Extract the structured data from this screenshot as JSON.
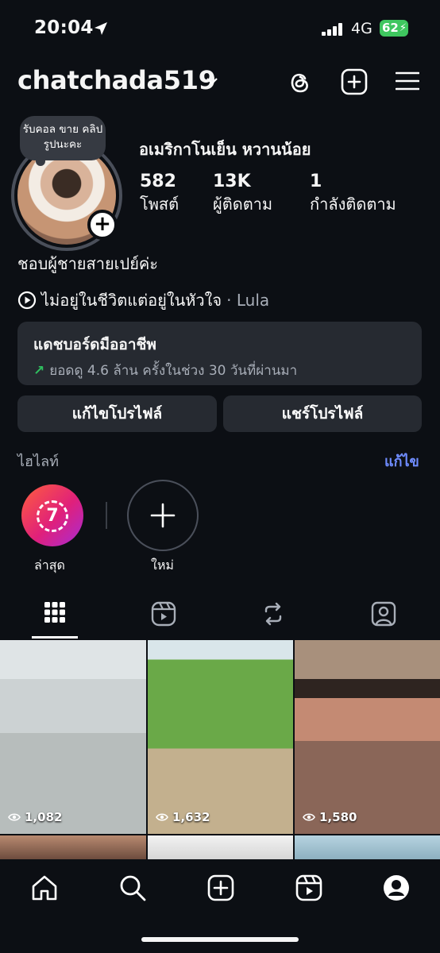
{
  "status": {
    "time": "20:04",
    "network": "4G",
    "battery": "62"
  },
  "header": {
    "username": "chatchada519"
  },
  "profile": {
    "note": "รับคอล ขาย คลิปรูปนะคะ",
    "display_name": "อเมริกาโนเย็น หวานน้อย",
    "stats": [
      {
        "value": "582",
        "label": "โพสต์"
      },
      {
        "value": "13K",
        "label": "ผู้ติดตาม"
      },
      {
        "value": "1",
        "label": "กำลังติดตาม"
      }
    ],
    "bio": "ชอบผู้ชายสายเปย์ค่ะ",
    "music_title": "ไม่อยู่ในชีวิตแต่อยู่ในหัวใจ",
    "music_artist": "· Lula"
  },
  "dashboard": {
    "title": "แดชบอร์ดมืออาชีพ",
    "subtitle": "ยอดดู 4.6 ล้าน ครั้งในช่วง 30 วันที่ผ่านมา",
    "trend_color": "#2fbf5f"
  },
  "buttons": {
    "edit": "แก้ไขโปรไฟล์",
    "share": "แชร์โปรไฟล์"
  },
  "highlights": {
    "title": "ไฮไลท์",
    "edit": "แก้ไข",
    "items": [
      {
        "label": "ล่าสุด",
        "badge": "7"
      },
      {
        "label": "ใหม่"
      }
    ]
  },
  "tabs": [
    "grid-icon",
    "reels-icon",
    "reposts-icon",
    "tagged-icon"
  ],
  "posts": [
    {
      "views": "1,082"
    },
    {
      "views": "1,632"
    },
    {
      "views": "1,580"
    }
  ],
  "nav": [
    "home-icon",
    "search-icon",
    "create-icon",
    "reels-icon",
    "profile-icon"
  ],
  "colors": {
    "background": "#0c0f14",
    "card": "#262a31",
    "accent_link": "#6f8cff",
    "battery": "#3fc65f"
  }
}
